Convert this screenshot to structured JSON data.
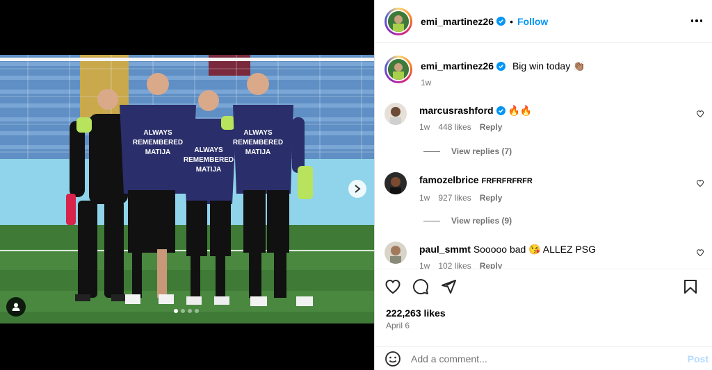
{
  "post": {
    "author": "emi_martinez26",
    "follow_label": "Follow",
    "separator": "•",
    "caption_text": "Big win today 👏🏽",
    "caption_time": "1w",
    "likes": "222,263 likes",
    "date": "April 6"
  },
  "media": {
    "shirt_text": [
      "ALWAYS",
      "REMEMBERED",
      "MATIJA"
    ],
    "carousel_count": 4,
    "carousel_active": 1
  },
  "comments": [
    {
      "user": "marcusrashford",
      "verified": true,
      "text": "🔥🔥",
      "time": "1w",
      "likes": "448 likes",
      "reply": "Reply",
      "view_replies": "View replies (7)"
    },
    {
      "user": "famozelbrice",
      "verified": false,
      "text": "FRFRFRFRFR",
      "time": "1w",
      "likes": "927 likes",
      "reply": "Reply",
      "view_replies": "View replies (9)"
    },
    {
      "user": "paul_smmt",
      "verified": false,
      "text": "Sooooo bad 😘 ALLEZ PSG",
      "time": "1w",
      "likes": "102 likes",
      "reply": "Reply"
    }
  ],
  "composer": {
    "placeholder": "Add a comment...",
    "post_label": "Post"
  },
  "colors": {
    "accent": "#0095f6",
    "verified": "#0095f6",
    "muted": "#737373"
  }
}
